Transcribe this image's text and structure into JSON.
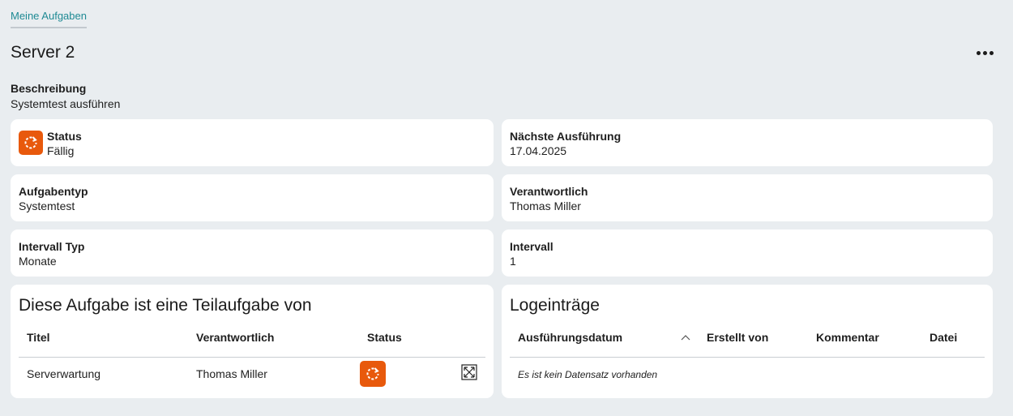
{
  "breadcrumb": "Meine Aufgaben",
  "title": "Server 2",
  "description": {
    "label": "Beschreibung",
    "value": "Systemtest ausführen"
  },
  "fields": {
    "status": {
      "label": "Status",
      "value": "Fällig"
    },
    "next_run": {
      "label": "Nächste Ausführung",
      "value": "17.04.2025"
    },
    "task_type": {
      "label": "Aufgabentyp",
      "value": "Systemtest"
    },
    "responsible": {
      "label": "Verantwortlich",
      "value": "Thomas Miller"
    },
    "interval_type": {
      "label": "Intervall Typ",
      "value": "Monate"
    },
    "interval": {
      "label": "Intervall",
      "value": "1"
    }
  },
  "parent_task": {
    "heading": "Diese Aufgabe ist eine Teilaufgabe von",
    "columns": [
      "Titel",
      "Verantwortlich",
      "Status"
    ],
    "rows": [
      {
        "title": "Serverwartung",
        "responsible": "Thomas Miller"
      }
    ]
  },
  "log": {
    "heading": "Logeinträge",
    "columns": [
      "Ausführungsdatum",
      "Erstellt von",
      "Kommentar",
      "Datei"
    ],
    "empty": "Es ist kein Datensatz vorhanden"
  },
  "colors": {
    "accent": "#1f8a94",
    "status": "#e8590c",
    "background": "#e9edf0"
  },
  "icons": {
    "status": "refresh-icon",
    "expand": "expand-icon",
    "sort": "sort-asc-icon",
    "more": "more-icon"
  }
}
